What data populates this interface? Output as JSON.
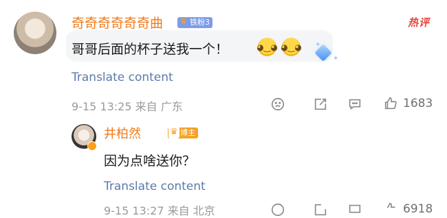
{
  "comment": {
    "username": "奇奇奇奇奇奇曲",
    "badge": "铁粉3",
    "hot_tag": "热评",
    "text": "哥哥后面的杯子送我一个！",
    "translate": "Translate content",
    "timestamp": "9-15 13:25",
    "source_prefix": "来自",
    "location": "广东",
    "like_count": "1683"
  },
  "reply": {
    "username": "井柏然",
    "badge": "博主",
    "text": "因为点啥送你？",
    "translate": "Translate content",
    "meta_partial": "9-15 13:27  来自  北京",
    "like_count_partial": "6918"
  },
  "icons": {
    "dislike": "sad-face-icon",
    "share": "share-icon",
    "comment": "comment-icon",
    "like": "thumbs-up-icon"
  },
  "colors": {
    "username": "#f07a1a",
    "link": "#5a7aa9",
    "hot": "#e9443b",
    "fan_badge": "#7d9ce8",
    "blogger_badge": "#f5a225"
  }
}
